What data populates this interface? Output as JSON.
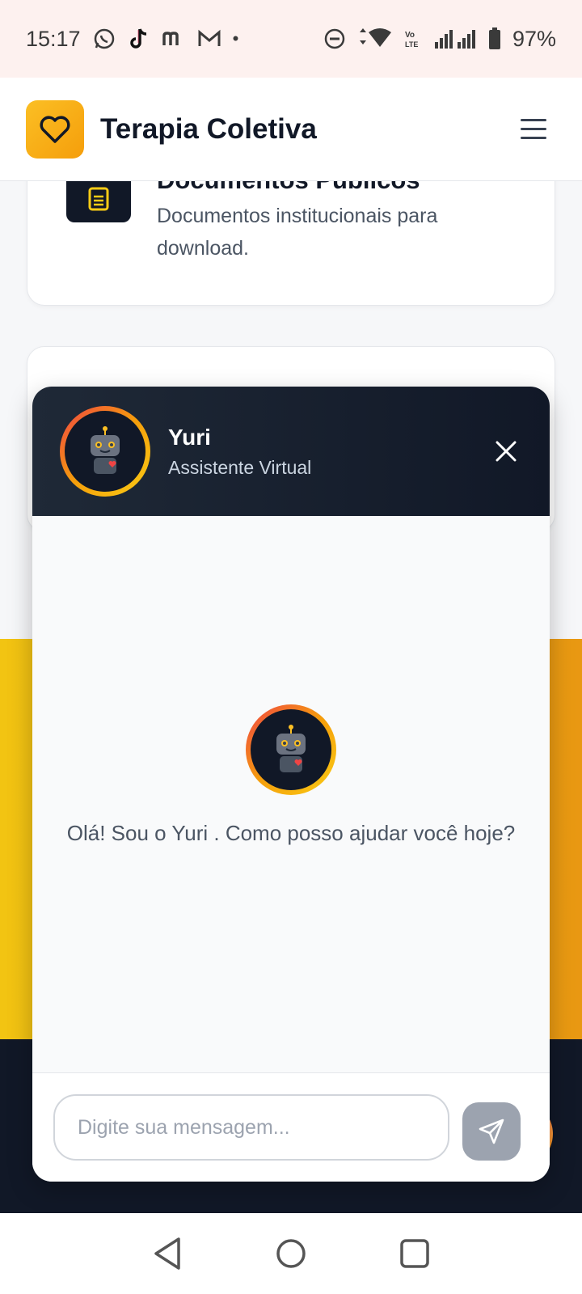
{
  "status_bar": {
    "time": "15:17",
    "battery": "97%",
    "network_label": "Vo LTE"
  },
  "header": {
    "title": "Terapia Coletiva",
    "logo_icon": "heart-icon",
    "menu_icon": "hamburger-menu-icon"
  },
  "background": {
    "card_title": "Documentos Públicos",
    "card_description": "Documentos institucionais para download.",
    "card_icon": "document-icon"
  },
  "chat": {
    "bot_name": "Yuri",
    "bot_role": "Assistente Virtual",
    "welcome_message": "Olá! Sou o Yuri . Como posso ajudar você hoje?",
    "input_placeholder": "Digite sua mensagem...",
    "input_value": "",
    "send_icon": "send-icon",
    "close_icon": "close-icon"
  },
  "colors": {
    "accent": "#f59e0b",
    "dark": "#111827",
    "yellow": "#f2c412"
  }
}
